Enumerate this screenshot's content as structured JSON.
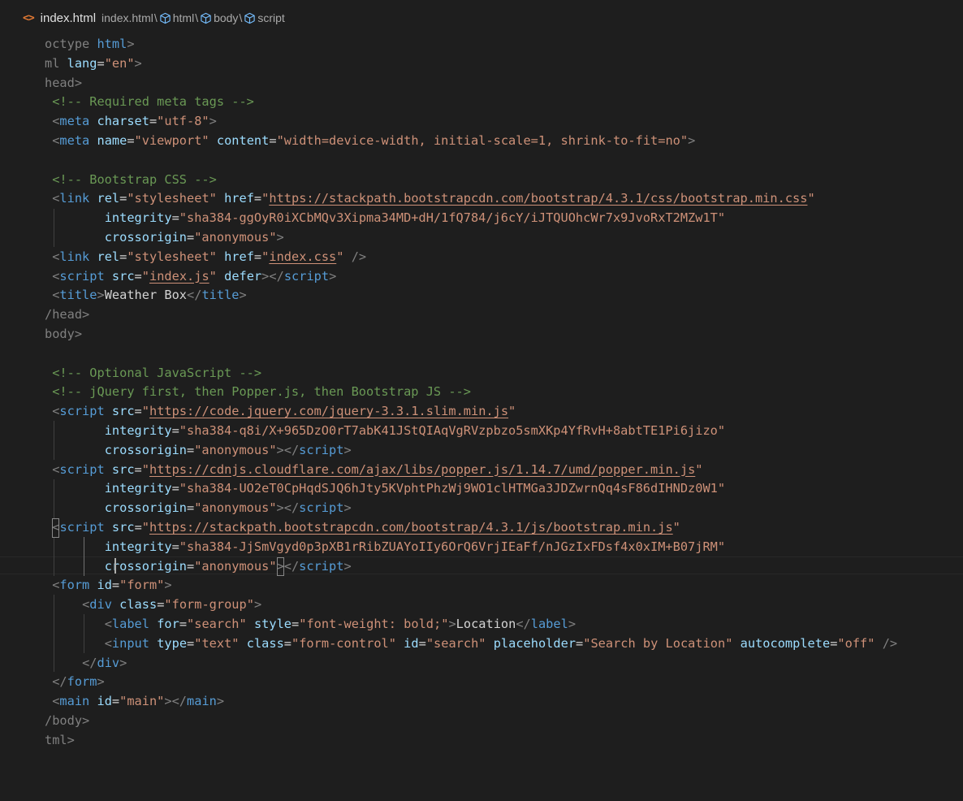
{
  "breadcrumb": {
    "file_icon": "<>",
    "file_name": "index.html",
    "path": [
      "index.html",
      "html",
      "body",
      "script"
    ],
    "separator": "\\"
  },
  "colors": {
    "background": "#1e1e1e",
    "tag": "#569cd6",
    "attribute": "#9cdcfe",
    "string": "#ce9178",
    "comment": "#6a9955",
    "punctuation": "#808080",
    "text": "#d4d4d4",
    "file_icon": "#e37933",
    "symbol_icon": "#75beff"
  },
  "editor": {
    "language": "html",
    "lines": [
      [
        [
          "t",
          "octype "
        ],
        [
          "tn",
          "html"
        ],
        [
          "t",
          ">"
        ]
      ],
      [
        [
          "t",
          "ml "
        ],
        [
          "an",
          "lang"
        ],
        [
          "tx",
          "="
        ],
        [
          "av",
          "\"en\""
        ],
        [
          "t",
          ">"
        ]
      ],
      [
        [
          "t",
          "head>"
        ]
      ],
      [
        [
          "t",
          " "
        ],
        [
          "cm",
          "<!-- Required meta tags -->"
        ]
      ],
      [
        [
          "t",
          " <"
        ],
        [
          "tn",
          "meta"
        ],
        [
          "tx",
          " "
        ],
        [
          "an",
          "charset"
        ],
        [
          "tx",
          "="
        ],
        [
          "av",
          "\"utf-8\""
        ],
        [
          "t",
          ">"
        ]
      ],
      [
        [
          "t",
          " <"
        ],
        [
          "tn",
          "meta"
        ],
        [
          "tx",
          " "
        ],
        [
          "an",
          "name"
        ],
        [
          "tx",
          "="
        ],
        [
          "av",
          "\"viewport\""
        ],
        [
          "tx",
          " "
        ],
        [
          "an",
          "content"
        ],
        [
          "tx",
          "="
        ],
        [
          "av",
          "\"width=device-width, initial-scale=1, shrink-to-fit=no\""
        ],
        [
          "t",
          ">"
        ]
      ],
      [],
      [
        [
          "t",
          " "
        ],
        [
          "cm",
          "<!-- Bootstrap CSS -->"
        ]
      ],
      [
        [
          "t",
          " <"
        ],
        [
          "tn",
          "link"
        ],
        [
          "tx",
          " "
        ],
        [
          "an",
          "rel"
        ],
        [
          "tx",
          "="
        ],
        [
          "av",
          "\"stylesheet\""
        ],
        [
          "tx",
          " "
        ],
        [
          "an",
          "href"
        ],
        [
          "tx",
          "="
        ],
        [
          "av",
          "\""
        ],
        [
          "avu",
          "https://stackpath.bootstrapcdn.com/bootstrap/4.3.1/css/bootstrap.min.css"
        ],
        [
          "av",
          "\""
        ]
      ],
      [
        [
          "tx",
          "        "
        ],
        [
          "an",
          "integrity"
        ],
        [
          "tx",
          "="
        ],
        [
          "av",
          "\"sha384-ggOyR0iXCbMQv3Xipma34MD+dH/1fQ784/j6cY/iJTQUOhcWr7x9JvoRxT2MZw1T\""
        ]
      ],
      [
        [
          "tx",
          "        "
        ],
        [
          "an",
          "crossorigin"
        ],
        [
          "tx",
          "="
        ],
        [
          "av",
          "\"anonymous\""
        ],
        [
          "t",
          ">"
        ]
      ],
      [
        [
          "t",
          " <"
        ],
        [
          "tn",
          "link"
        ],
        [
          "tx",
          " "
        ],
        [
          "an",
          "rel"
        ],
        [
          "tx",
          "="
        ],
        [
          "av",
          "\"stylesheet\""
        ],
        [
          "tx",
          " "
        ],
        [
          "an",
          "href"
        ],
        [
          "tx",
          "="
        ],
        [
          "av",
          "\""
        ],
        [
          "avu",
          "index.css"
        ],
        [
          "av",
          "\""
        ],
        [
          "tx",
          " "
        ],
        [
          "t",
          "/>"
        ]
      ],
      [
        [
          "t",
          " <"
        ],
        [
          "tn",
          "script"
        ],
        [
          "tx",
          " "
        ],
        [
          "an",
          "src"
        ],
        [
          "tx",
          "="
        ],
        [
          "av",
          "\""
        ],
        [
          "avu",
          "index.js"
        ],
        [
          "av",
          "\""
        ],
        [
          "tx",
          " "
        ],
        [
          "an",
          "defer"
        ],
        [
          "t",
          "></"
        ],
        [
          "tn",
          "script"
        ],
        [
          "t",
          ">"
        ]
      ],
      [
        [
          "t",
          " <"
        ],
        [
          "tn",
          "title"
        ],
        [
          "t",
          ">"
        ],
        [
          "tx",
          "Weather Box"
        ],
        [
          "t",
          "</"
        ],
        [
          "tn",
          "title"
        ],
        [
          "t",
          ">"
        ]
      ],
      [
        [
          "t",
          "/head>"
        ]
      ],
      [
        [
          "t",
          "body>"
        ]
      ],
      [],
      [
        [
          "t",
          " "
        ],
        [
          "cm",
          "<!-- Optional JavaScript -->"
        ]
      ],
      [
        [
          "t",
          " "
        ],
        [
          "cm",
          "<!-- jQuery first, then Popper.js, then Bootstrap JS -->"
        ]
      ],
      [
        [
          "t",
          " <"
        ],
        [
          "tn",
          "script"
        ],
        [
          "tx",
          " "
        ],
        [
          "an",
          "src"
        ],
        [
          "tx",
          "="
        ],
        [
          "av",
          "\""
        ],
        [
          "avu",
          "https://code.jquery.com/jquery-3.3.1.slim.min.js"
        ],
        [
          "av",
          "\""
        ]
      ],
      [
        [
          "tx",
          "        "
        ],
        [
          "an",
          "integrity"
        ],
        [
          "tx",
          "="
        ],
        [
          "av",
          "\"sha384-q8i/X+965DzO0rT7abK41JStQIAqVgRVzpbzo5smXKp4YfRvH+8abtTE1Pi6jizo\""
        ]
      ],
      [
        [
          "tx",
          "        "
        ],
        [
          "an",
          "crossorigin"
        ],
        [
          "tx",
          "="
        ],
        [
          "av",
          "\"anonymous\""
        ],
        [
          "t",
          "></"
        ],
        [
          "tn",
          "script"
        ],
        [
          "t",
          ">"
        ]
      ],
      [
        [
          "t",
          " <"
        ],
        [
          "tn",
          "script"
        ],
        [
          "tx",
          " "
        ],
        [
          "an",
          "src"
        ],
        [
          "tx",
          "="
        ],
        [
          "av",
          "\""
        ],
        [
          "avu",
          "https://cdnjs.cloudflare.com/ajax/libs/popper.js/1.14.7/umd/popper.min.js"
        ],
        [
          "av",
          "\""
        ]
      ],
      [
        [
          "tx",
          "        "
        ],
        [
          "an",
          "integrity"
        ],
        [
          "tx",
          "="
        ],
        [
          "av",
          "\"sha384-UO2eT0CpHqdSJQ6hJty5KVphtPhzWj9WO1clHTMGa3JDZwrnQq4sF86dIHNDz0W1\""
        ]
      ],
      [
        [
          "tx",
          "        "
        ],
        [
          "an",
          "crossorigin"
        ],
        [
          "tx",
          "="
        ],
        [
          "av",
          "\"anonymous\""
        ],
        [
          "t",
          "></"
        ],
        [
          "tn",
          "script"
        ],
        [
          "t",
          ">"
        ]
      ],
      [
        [
          "t",
          " <"
        ],
        [
          "tn",
          "script"
        ],
        [
          "tx",
          " "
        ],
        [
          "an",
          "src"
        ],
        [
          "tx",
          "="
        ],
        [
          "av",
          "\""
        ],
        [
          "avu",
          "https://stackpath.bootstrapcdn.com/bootstrap/4.3.1/js/bootstrap.min.js"
        ],
        [
          "av",
          "\""
        ]
      ],
      [
        [
          "tx",
          "        "
        ],
        [
          "an",
          "integrity"
        ],
        [
          "tx",
          "="
        ],
        [
          "av",
          "\"sha384-JjSmVgyd0p3pXB1rRibZUAYoIIy6OrQ6VrjIEaFf/nJGzIxFDsf4x0xIM+B07jRM\""
        ]
      ],
      [
        [
          "tx",
          "        "
        ],
        [
          "an",
          "crossorigin"
        ],
        [
          "tx",
          "="
        ],
        [
          "av",
          "\"anonymous\""
        ],
        [
          "t",
          "></"
        ],
        [
          "tn",
          "script"
        ],
        [
          "t",
          ">"
        ]
      ],
      [
        [
          "t",
          " <"
        ],
        [
          "tn",
          "form"
        ],
        [
          "tx",
          " "
        ],
        [
          "an",
          "id"
        ],
        [
          "tx",
          "="
        ],
        [
          "av",
          "\"form\""
        ],
        [
          "t",
          ">"
        ]
      ],
      [
        [
          "tx",
          "     "
        ],
        [
          "t",
          "<"
        ],
        [
          "tn",
          "div"
        ],
        [
          "tx",
          " "
        ],
        [
          "an",
          "class"
        ],
        [
          "tx",
          "="
        ],
        [
          "av",
          "\"form-group\""
        ],
        [
          "t",
          ">"
        ]
      ],
      [
        [
          "tx",
          "        "
        ],
        [
          "t",
          "<"
        ],
        [
          "tn",
          "label"
        ],
        [
          "tx",
          " "
        ],
        [
          "an",
          "for"
        ],
        [
          "tx",
          "="
        ],
        [
          "av",
          "\"search\""
        ],
        [
          "tx",
          " "
        ],
        [
          "an",
          "style"
        ],
        [
          "tx",
          "="
        ],
        [
          "av",
          "\"font-weight: bold;\""
        ],
        [
          "t",
          ">"
        ],
        [
          "tx",
          "Location"
        ],
        [
          "t",
          "</"
        ],
        [
          "tn",
          "label"
        ],
        [
          "t",
          ">"
        ]
      ],
      [
        [
          "tx",
          "        "
        ],
        [
          "t",
          "<"
        ],
        [
          "tn",
          "input"
        ],
        [
          "tx",
          " "
        ],
        [
          "an",
          "type"
        ],
        [
          "tx",
          "="
        ],
        [
          "av",
          "\"text\""
        ],
        [
          "tx",
          " "
        ],
        [
          "an",
          "class"
        ],
        [
          "tx",
          "="
        ],
        [
          "av",
          "\"form-control\""
        ],
        [
          "tx",
          " "
        ],
        [
          "an",
          "id"
        ],
        [
          "tx",
          "="
        ],
        [
          "av",
          "\"search\""
        ],
        [
          "tx",
          " "
        ],
        [
          "an",
          "placeholder"
        ],
        [
          "tx",
          "="
        ],
        [
          "av",
          "\"Search by Location\""
        ],
        [
          "tx",
          " "
        ],
        [
          "an",
          "autocomplete"
        ],
        [
          "tx",
          "="
        ],
        [
          "av",
          "\"off\""
        ],
        [
          "tx",
          " "
        ],
        [
          "t",
          "/>"
        ]
      ],
      [
        [
          "tx",
          "     "
        ],
        [
          "t",
          "</"
        ],
        [
          "tn",
          "div"
        ],
        [
          "t",
          ">"
        ]
      ],
      [
        [
          "t",
          " </"
        ],
        [
          "tn",
          "form"
        ],
        [
          "t",
          ">"
        ]
      ],
      [
        [
          "t",
          " <"
        ],
        [
          "tn",
          "main"
        ],
        [
          "tx",
          " "
        ],
        [
          "an",
          "id"
        ],
        [
          "tx",
          "="
        ],
        [
          "av",
          "\"main\""
        ],
        [
          "t",
          "></"
        ],
        [
          "tn",
          "main"
        ],
        [
          "t",
          ">"
        ]
      ],
      [
        [
          "t",
          "/body>"
        ]
      ],
      [
        [
          "t",
          "tml>"
        ]
      ]
    ]
  }
}
